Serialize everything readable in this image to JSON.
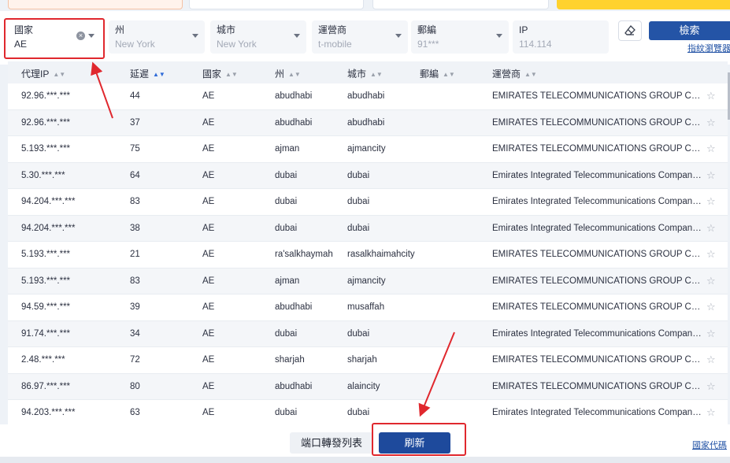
{
  "filters": {
    "country": {
      "label": "國家",
      "value": "AE"
    },
    "state": {
      "label": "州",
      "placeholder": "New York"
    },
    "city": {
      "label": "城市",
      "placeholder": "New York"
    },
    "isp": {
      "label": "運營商",
      "placeholder": "t-mobile"
    },
    "zip": {
      "label": "郵編",
      "placeholder": "91***"
    },
    "ip": {
      "label": "IP",
      "placeholder": "114.114"
    },
    "search_label": "檢索",
    "fingerprint_link": "指紋瀏覽器"
  },
  "table": {
    "headers": {
      "ip": "代理IP",
      "latency": "延遲",
      "country": "國家",
      "state": "州",
      "city": "城市",
      "zip": "郵編",
      "isp": "運營商"
    },
    "rows": [
      {
        "ip": "92.96.***.***",
        "latency": "44",
        "country": "AE",
        "state": "abudhabi",
        "city": "abudhabi",
        "isp": "EMIRATES TELECOMMUNICATIONS GROUP COMP..."
      },
      {
        "ip": "92.96.***.***",
        "latency": "37",
        "country": "AE",
        "state": "abudhabi",
        "city": "abudhabi",
        "isp": "EMIRATES TELECOMMUNICATIONS GROUP COMP..."
      },
      {
        "ip": "5.193.***.***",
        "latency": "75",
        "country": "AE",
        "state": "ajman",
        "city": "ajmancity",
        "isp": "EMIRATES TELECOMMUNICATIONS GROUP COMP..."
      },
      {
        "ip": "5.30.***.***",
        "latency": "64",
        "country": "AE",
        "state": "dubai",
        "city": "dubai",
        "isp": "Emirates Integrated Telecommunications Company ..."
      },
      {
        "ip": "94.204.***.***",
        "latency": "83",
        "country": "AE",
        "state": "dubai",
        "city": "dubai",
        "isp": "Emirates Integrated Telecommunications Company ..."
      },
      {
        "ip": "94.204.***.***",
        "latency": "38",
        "country": "AE",
        "state": "dubai",
        "city": "dubai",
        "isp": "Emirates Integrated Telecommunications Company ..."
      },
      {
        "ip": "5.193.***.***",
        "latency": "21",
        "country": "AE",
        "state": "ra'salkhaymah",
        "city": "rasalkhaimahcity",
        "isp": "EMIRATES TELECOMMUNICATIONS GROUP COMP..."
      },
      {
        "ip": "5.193.***.***",
        "latency": "83",
        "country": "AE",
        "state": "ajman",
        "city": "ajmancity",
        "isp": "EMIRATES TELECOMMUNICATIONS GROUP COMP..."
      },
      {
        "ip": "94.59.***.***",
        "latency": "39",
        "country": "AE",
        "state": "abudhabi",
        "city": "musaffah",
        "isp": "EMIRATES TELECOMMUNICATIONS GROUP COMP..."
      },
      {
        "ip": "91.74.***.***",
        "latency": "34",
        "country": "AE",
        "state": "dubai",
        "city": "dubai",
        "isp": "Emirates Integrated Telecommunications Company ..."
      },
      {
        "ip": "2.48.***.***",
        "latency": "72",
        "country": "AE",
        "state": "sharjah",
        "city": "sharjah",
        "isp": "EMIRATES TELECOMMUNICATIONS GROUP COMP..."
      },
      {
        "ip": "86.97.***.***",
        "latency": "80",
        "country": "AE",
        "state": "abudhabi",
        "city": "alaincity",
        "isp": "EMIRATES TELECOMMUNICATIONS GROUP COMP..."
      },
      {
        "ip": "94.203.***.***",
        "latency": "63",
        "country": "AE",
        "state": "dubai",
        "city": "dubai",
        "isp": "Emirates Integrated Telecommunications Company ..."
      }
    ]
  },
  "footer": {
    "port_forward_label": "端口轉發列表",
    "refresh_label": "刷新",
    "country_code_link": "國家代碼"
  },
  "colors": {
    "primary": "#1e4a9c",
    "annotation_red": "#e0282e"
  }
}
